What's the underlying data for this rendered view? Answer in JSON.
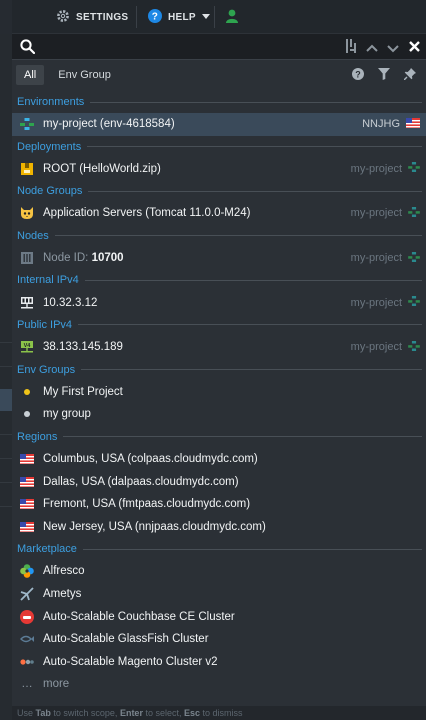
{
  "topbar": {
    "settings_label": "SETTINGS",
    "help_label": "HELP"
  },
  "search": {
    "value": "",
    "placeholder": ""
  },
  "filters": {
    "all": "All",
    "env_group": "Env Group"
  },
  "sections": {
    "environments": "Environments",
    "deployments": "Deployments",
    "node_groups": "Node Groups",
    "nodes": "Nodes",
    "internal_ipv4": "Internal IPv4",
    "public_ipv4": "Public IPv4",
    "env_groups": "Env Groups",
    "regions": "Regions",
    "marketplace": "Marketplace"
  },
  "environment": {
    "label": "my-project (env-4618584)",
    "region_code": "NNJHG"
  },
  "deployment": {
    "label": "ROOT (HelloWorld.zip)",
    "env": "my-project"
  },
  "node_group": {
    "label": "Application Servers (Tomcat 11.0.0-M24)",
    "env": "my-project"
  },
  "node": {
    "prefix": "Node ID:",
    "id": "10700",
    "env": "my-project"
  },
  "internal_ip": {
    "label": "10.32.3.12",
    "env": "my-project"
  },
  "public_ip": {
    "label": "38.133.145.189",
    "env": "my-project"
  },
  "env_groups": [
    {
      "label": "My First Project",
      "color": "#f0c419"
    },
    {
      "label": "my group",
      "color": "#c9d0d6"
    }
  ],
  "regions": [
    {
      "label": "Columbus, USA (colpaas.cloudmydc.com)"
    },
    {
      "label": "Dallas, USA (dalpaas.cloudmydc.com)"
    },
    {
      "label": "Fremont, USA (fmtpaas.cloudmydc.com)"
    },
    {
      "label": "New Jersey, USA (nnjpaas.cloudmydc.com)"
    }
  ],
  "marketplace": [
    {
      "label": "Alfresco",
      "icon": "alfresco-icon"
    },
    {
      "label": "Ametys",
      "icon": "ametys-icon"
    },
    {
      "label": "Auto-Scalable Couchbase CE Cluster",
      "icon": "couchbase-icon"
    },
    {
      "label": "Auto-Scalable GlassFish Cluster",
      "icon": "glassfish-icon"
    },
    {
      "label": "Auto-Scalable Magento Cluster v2",
      "icon": "magento-icon"
    }
  ],
  "more_label": "more",
  "footer": {
    "use": "Use",
    "tab": "Tab",
    "switch": "to switch scope,",
    "enter": "Enter",
    "select": "to select,",
    "esc": "Esc",
    "dismiss": "to dismiss"
  },
  "colors": {
    "accent": "#3d9fe0",
    "env_green": "#2ea44f",
    "panel": "#2b3036"
  }
}
